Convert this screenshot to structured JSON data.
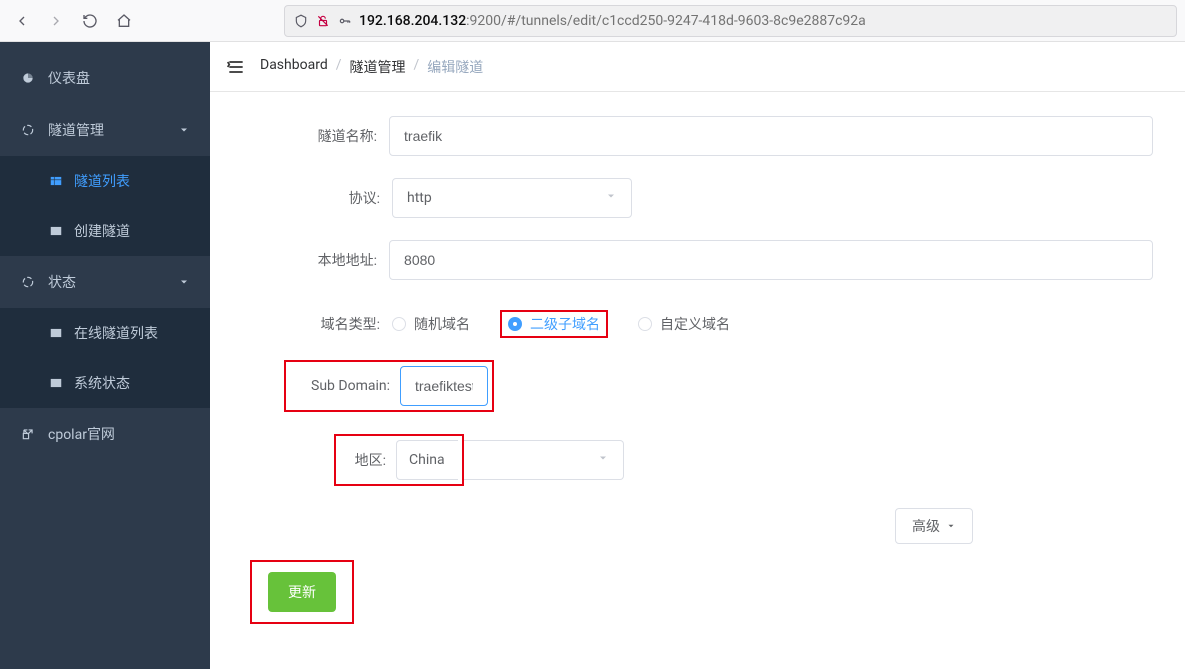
{
  "browser": {
    "url_host": "192.168.204.132",
    "url_rest": ":9200/#/tunnels/edit/c1ccd250-9247-418d-9603-8c9e2887c92a"
  },
  "sidebar": {
    "dashboard": "仪表盘",
    "tunnels_group": "隧道管理",
    "tunnel_list": "隧道列表",
    "create_tunnel": "创建隧道",
    "status_group": "状态",
    "online_tunnels": "在线隧道列表",
    "system_status": "系统状态",
    "cpolar_site": "cpolar官网"
  },
  "breadcrumb": {
    "a": "Dashboard",
    "b": "隧道管理",
    "c": "编辑隧道"
  },
  "form": {
    "tunnel_name_label": "隧道名称:",
    "tunnel_name_value": "traefik",
    "protocol_label": "协议:",
    "protocol_value": "http",
    "local_addr_label": "本地地址:",
    "local_addr_value": "8080",
    "domain_type_label": "域名类型:",
    "domain_type_random": "随机域名",
    "domain_type_sub": "二级子域名",
    "domain_type_custom": "自定义域名",
    "sub_domain_label": "Sub Domain:",
    "sub_domain_value": "traefiktest",
    "region_label": "地区:",
    "region_value": "China",
    "advanced_label": "高级",
    "update_btn": "更新"
  }
}
